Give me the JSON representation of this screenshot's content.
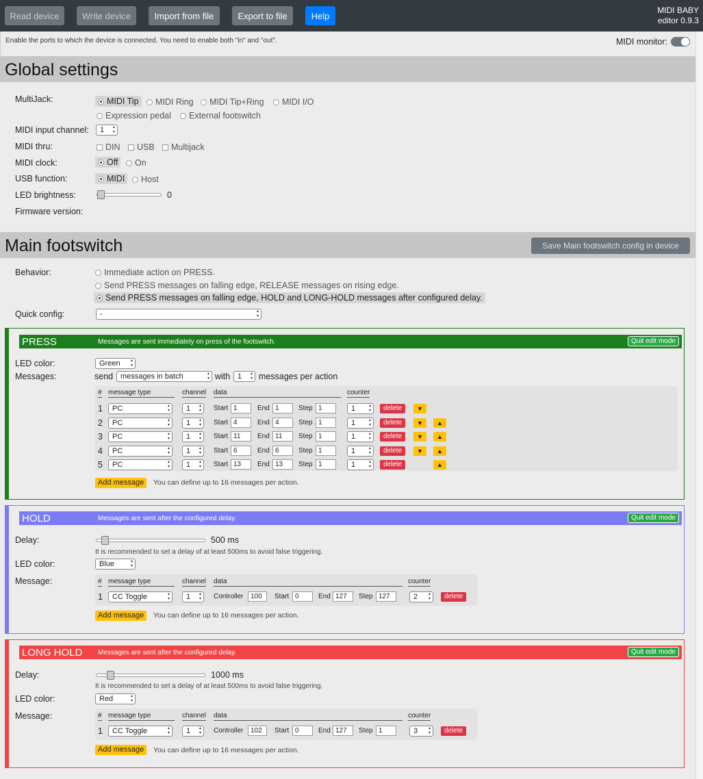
{
  "toolbar": {
    "read": "Read device",
    "write": "Write device",
    "import": "Import from file",
    "export": "Export to file",
    "help": "Help"
  },
  "brand": {
    "name": "MIDI BABY",
    "version": "editor 0.9.3"
  },
  "info": {
    "text": "Enable the ports to which the device is connected. You need to enable both \"in\" and \"out\".",
    "monitor_label": "MIDI monitor:"
  },
  "global": {
    "title": "Global settings",
    "multijack_label": "MultiJack:",
    "multijack_options": [
      "MIDI Tip",
      "MIDI Ring",
      "MIDI Tip+Ring",
      "MIDI I/O",
      "Expression pedal",
      "External footswitch"
    ],
    "input_channel_label": "MIDI input channel:",
    "input_channel": "1",
    "thru_label": "MIDI thru:",
    "thru_options": [
      "DIN",
      "USB",
      "Multijack"
    ],
    "clock_label": "MIDI clock:",
    "clock_options": [
      "Off",
      "On"
    ],
    "usb_label": "USB function:",
    "usb_options": [
      "MIDI",
      "Host"
    ],
    "led_label": "LED brightness:",
    "led_value": "0",
    "led_level": 0,
    "firmware_label": "Firmware version:"
  },
  "main": {
    "title": "Main footswitch",
    "save": "Save Main footswitch config in device",
    "behavior_label": "Behavior:",
    "behavior_options": [
      "Immediate action on PRESS.",
      "Send PRESS messages on falling edge, RELEASE messages on rising edge.",
      "Send PRESS messages on falling edge, HOLD and LONG-HOLD messages after configured delay."
    ],
    "quick_label": "Quick config:",
    "quick_value": "-"
  },
  "press": {
    "title": "PRESS",
    "subtitle": "Messages are sent immediately on press of the footswitch.",
    "quit": "Quit edit mode",
    "color": "#1b7f1b",
    "led_label": "LED color:",
    "led_value": "Green",
    "messages_label": "Messages:",
    "send": "send",
    "mode": "messages in batch",
    "with": "with",
    "per": "1",
    "per_label": "messages per action",
    "headers": {
      "num": "#",
      "type": "message type",
      "channel": "channel",
      "data": "data",
      "counter": "counter"
    },
    "start": "Start",
    "end": "End",
    "step": "Step",
    "delete": "delete",
    "rows": [
      {
        "n": "1",
        "type": "PC",
        "ch": "1",
        "start": "1",
        "end": "1",
        "step": "1",
        "counter": "1"
      },
      {
        "n": "2",
        "type": "PC",
        "ch": "1",
        "start": "4",
        "end": "4",
        "step": "1",
        "counter": "1"
      },
      {
        "n": "3",
        "type": "PC",
        "ch": "1",
        "start": "11",
        "end": "11",
        "step": "1",
        "counter": "1"
      },
      {
        "n": "4",
        "type": "PC",
        "ch": "1",
        "start": "6",
        "end": "6",
        "step": "1",
        "counter": "1"
      },
      {
        "n": "5",
        "type": "PC",
        "ch": "1",
        "start": "13",
        "end": "13",
        "step": "1",
        "counter": "1"
      }
    ],
    "add": "Add message",
    "hint": "You can define up to 16 messages per action."
  },
  "hold": {
    "title": "HOLD",
    "subtitle": "Messages are sent after the configured delay.",
    "quit": "Quit edit mode",
    "color": "#7b7bf5",
    "delay_label": "Delay:",
    "delay_value": "500 ms",
    "delay_level": 0.05,
    "recommend": "It is recommended to set a delay of at least 500ms to avoid false triggering.",
    "led_label": "LED color:",
    "led_value": "Blue",
    "message_label": "Message:",
    "headers": {
      "num": "#",
      "type": "message type",
      "channel": "channel",
      "data": "data",
      "counter": "counter"
    },
    "row": {
      "n": "1",
      "type": "CC Toggle",
      "ch": "1",
      "controller_label": "Controller",
      "controller": "100",
      "start_label": "Start",
      "start": "0",
      "end_label": "End",
      "end": "127",
      "step_label": "Step",
      "step": "127",
      "counter": "2"
    },
    "delete": "delete",
    "add": "Add message",
    "hint": "You can define up to 16 messages per action."
  },
  "longhold": {
    "title": "LONG HOLD",
    "subtitle": "Messages are sent after the configured delay.",
    "quit": "Quit edit mode",
    "color": "#f24444",
    "delay_label": "Delay:",
    "delay_value": "1000 ms",
    "delay_level": 0.1,
    "recommend": "It is recommended to set a delay of at least 500ms to avoid false triggering.",
    "led_label": "LED color:",
    "led_value": "Red",
    "message_label": "Message:",
    "headers": {
      "num": "#",
      "type": "message type",
      "channel": "channel",
      "data": "data",
      "counter": "counter"
    },
    "row": {
      "n": "1",
      "type": "CC Toggle",
      "ch": "1",
      "controller_label": "Controller",
      "controller": "102",
      "start_label": "Start",
      "start": "0",
      "end_label": "End",
      "end": "127",
      "step_label": "Step",
      "step": "1",
      "counter": "3"
    },
    "delete": "delete",
    "add": "Add message",
    "hint": "You can define up to 16 messages per action."
  }
}
